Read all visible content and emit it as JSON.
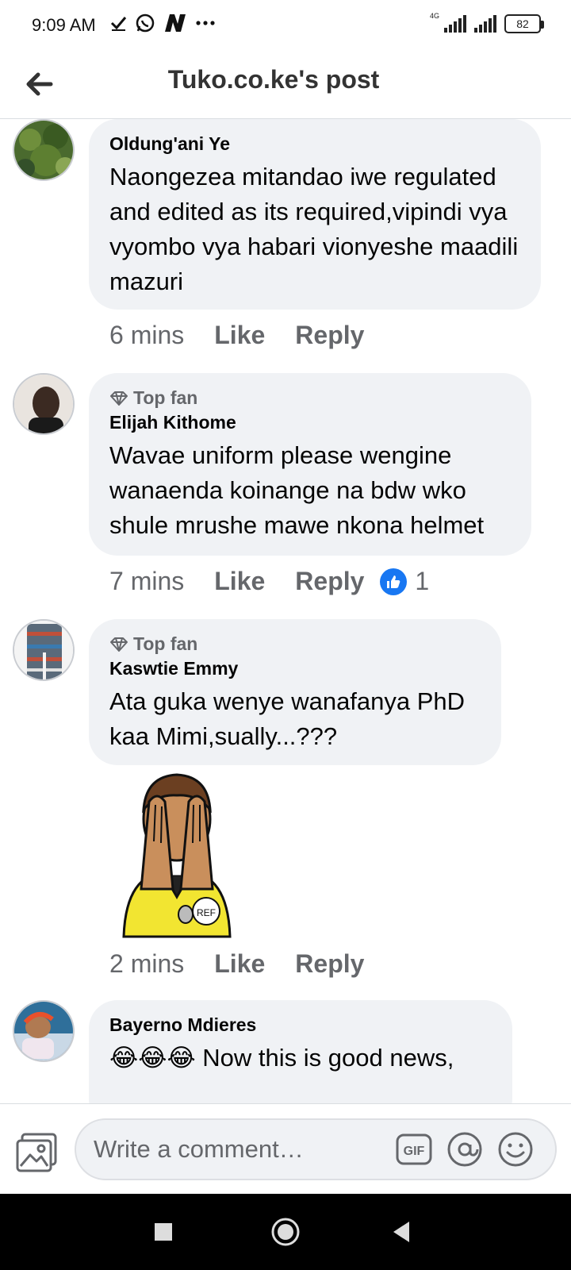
{
  "status_bar": {
    "time": "9:09 AM",
    "left_icons": [
      "check-icon",
      "whatsapp-icon",
      "n-app-icon",
      "more-dots-icon"
    ],
    "network_label": "4G",
    "battery": "82"
  },
  "header": {
    "title": "Tuko.co.ke's post",
    "back_icon": "arrow-left-icon"
  },
  "comments": [
    {
      "author": "Oldung'ani Ye",
      "top_fan": false,
      "text": "Naongezea mitandao iwe regulated and edited as its required,vipindi vya vyombo vya habari vionyeshe maadili mazuri",
      "time": "6 mins",
      "like_label": "Like",
      "reply_label": "Reply"
    },
    {
      "author": "Elijah Kithome",
      "top_fan": true,
      "badge_label": "Top fan",
      "text": "Wavae uniform please wengine wanaenda koinange na bdw wko shule mrushe mawe nkona helmet",
      "time": "7 mins",
      "like_label": "Like",
      "reply_label": "Reply",
      "reaction_count": "1"
    },
    {
      "author": "Kaswtie Emmy",
      "top_fan": true,
      "badge_label": "Top fan",
      "text": "Ata guka wenye wanafanya PhD kaa Mimi,sually...???",
      "sticker_text": "REF",
      "time": "2 mins",
      "like_label": "Like",
      "reply_label": "Reply"
    },
    {
      "author": "Bayerno Mdieres",
      "top_fan": false,
      "emojis": "😂😂😂",
      "text": " Now this is good news,"
    }
  ],
  "composer": {
    "placeholder": "Write a comment…",
    "gif_label": "GIF"
  },
  "colors": {
    "bubble": "#f0f2f5",
    "secondary_text": "#65676b",
    "accent": "#1877f2"
  }
}
